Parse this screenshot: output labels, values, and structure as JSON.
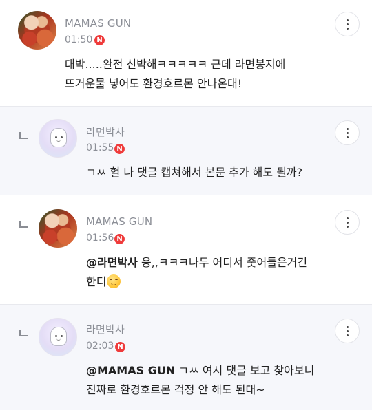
{
  "comments": [
    {
      "nickname": "MAMAS GUN",
      "time": "01:50",
      "badge": "N",
      "lines": [
        "대박.....완전 신박해ㅋㅋㅋㅋㅋ 근데 라면봉지에",
        "뜨거운물 넣어도 환경호르몬 안나온대!"
      ],
      "avatar": "food-photo-avatar"
    },
    {
      "nickname": "라면박사",
      "time": "01:55",
      "badge": "N",
      "lines": [
        "ㄱㅆ 헐 나 댓글 캡쳐해서 본문 추가 해도 될까?"
      ],
      "avatar": "penguin-bot-avatar"
    },
    {
      "nickname": "MAMAS GUN",
      "time": "01:56",
      "badge": "N",
      "mention": "@라면박사",
      "lines": [
        " 웅,,ㅋㅋㅋ나두 어디서 줏어들은거긴",
        "한디"
      ],
      "emoji": "smiling-face-icon",
      "avatar": "food-photo-avatar"
    },
    {
      "nickname": "라면박사",
      "time": "02:03",
      "badge": "N",
      "mention": "@MAMAS GUN",
      "lines": [
        " ㄱㅆ 여시 댓글 보고 찾아보니",
        "진짜로 환경호르몬 걱정 안 해도 된대~"
      ],
      "avatar": "penguin-bot-avatar"
    }
  ],
  "colors": {
    "reply_bg": "#f6f7fb",
    "meta_text": "#8b8e96",
    "new_badge": "#ef3b3b"
  },
  "icons": {
    "more": "vertical-ellipsis-icon",
    "reply": "reply-arrow-icon"
  }
}
